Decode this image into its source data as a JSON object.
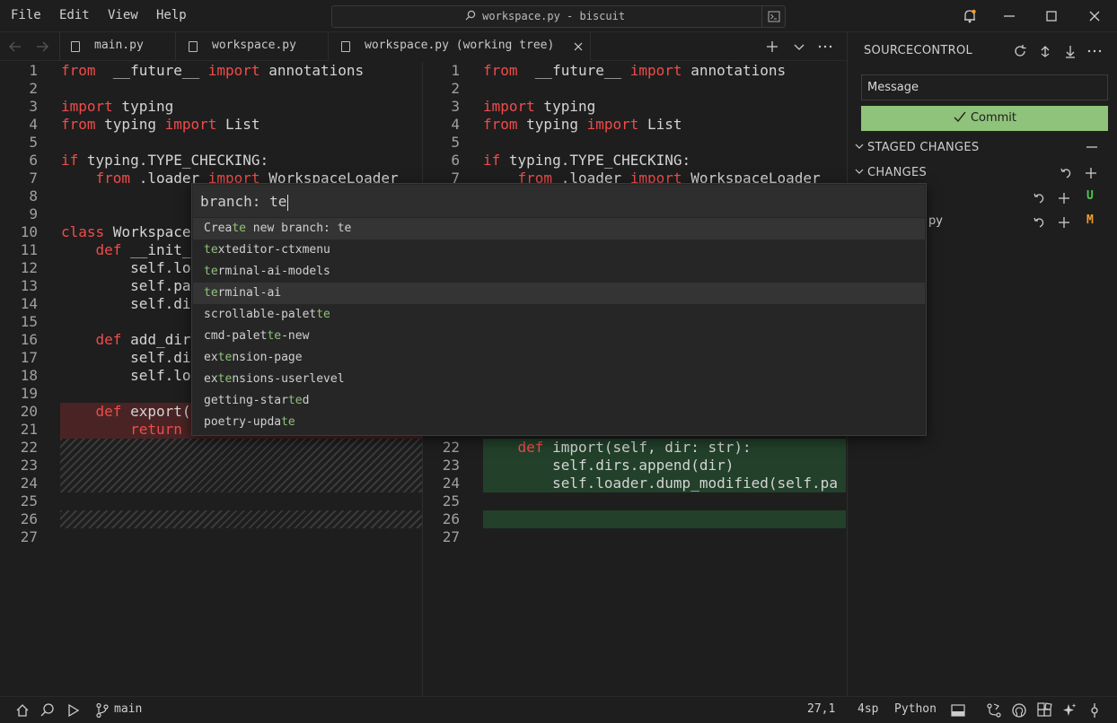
{
  "menu": [
    "File",
    "Edit",
    "View",
    "Help"
  ],
  "title": "workspace.py - biscuit",
  "tabs": [
    {
      "label": "main.py"
    },
    {
      "label": "workspace.py"
    },
    {
      "label": "workspace.py (working tree)"
    }
  ],
  "left_editor": {
    "lines": [
      {
        "n": "1",
        "t": [
          [
            "kw",
            "from"
          ],
          [
            "",
            "  __future__ "
          ],
          [
            "kw",
            "import"
          ],
          [
            "",
            " annotations"
          ]
        ]
      },
      {
        "n": "2",
        "t": []
      },
      {
        "n": "3",
        "t": [
          [
            "kw",
            "import"
          ],
          [
            "",
            " typing"
          ]
        ]
      },
      {
        "n": "4",
        "t": [
          [
            "kw",
            "from"
          ],
          [
            "",
            " typing "
          ],
          [
            "kw",
            "import"
          ],
          [
            "",
            " List"
          ]
        ]
      },
      {
        "n": "5",
        "t": []
      },
      {
        "n": "6",
        "t": [
          [
            "kw",
            "if"
          ],
          [
            "",
            " typing.TYPE_CHECKING:"
          ]
        ]
      },
      {
        "n": "7",
        "t": [
          [
            "",
            "    "
          ],
          [
            "kw",
            "from"
          ],
          [
            "",
            " .loader "
          ],
          [
            "kw",
            "import"
          ],
          [
            "",
            " WorkspaceLoader"
          ]
        ]
      },
      {
        "n": "8",
        "t": []
      },
      {
        "n": "9",
        "t": []
      },
      {
        "n": "10",
        "t": [
          [
            "kw",
            "class"
          ],
          [
            "",
            " Workspace"
          ]
        ]
      },
      {
        "n": "11",
        "t": [
          [
            "",
            "    "
          ],
          [
            "kw",
            "def"
          ],
          [
            "",
            " __init_"
          ]
        ]
      },
      {
        "n": "12",
        "t": [
          [
            "",
            "        self.lo"
          ]
        ]
      },
      {
        "n": "13",
        "t": [
          [
            "",
            "        self.pa"
          ]
        ]
      },
      {
        "n": "14",
        "t": [
          [
            "",
            "        self.di"
          ]
        ]
      },
      {
        "n": "15",
        "t": []
      },
      {
        "n": "16",
        "t": [
          [
            "",
            "    "
          ],
          [
            "kw",
            "def"
          ],
          [
            "",
            " add_dir"
          ]
        ]
      },
      {
        "n": "17",
        "t": [
          [
            "",
            "        self.di"
          ]
        ]
      },
      {
        "n": "18",
        "t": [
          [
            "",
            "        self.lo"
          ]
        ]
      },
      {
        "n": "19",
        "t": []
      },
      {
        "n": "20",
        "t": [
          [
            "",
            "    "
          ],
          [
            "kw",
            "def"
          ],
          [
            "",
            " export("
          ]
        ]
      },
      {
        "n": "21",
        "t": [
          [
            "",
            "        "
          ],
          [
            "kw",
            "return"
          ]
        ]
      },
      {
        "n": "22",
        "t": []
      },
      {
        "n": "23",
        "t": []
      },
      {
        "n": "24",
        "t": []
      },
      {
        "n": "25",
        "t": []
      },
      {
        "n": "26",
        "t": []
      },
      {
        "n": "27",
        "t": []
      }
    ]
  },
  "right_editor": {
    "lines": [
      {
        "n": "1",
        "t": [
          [
            "kw",
            "from"
          ],
          [
            "",
            "  __future__ "
          ],
          [
            "kw",
            "import"
          ],
          [
            "",
            " annotations"
          ]
        ]
      },
      {
        "n": "2",
        "t": []
      },
      {
        "n": "3",
        "t": [
          [
            "kw",
            "import"
          ],
          [
            "",
            " typing"
          ]
        ]
      },
      {
        "n": "4",
        "t": [
          [
            "kw",
            "from"
          ],
          [
            "",
            " typing "
          ],
          [
            "kw",
            "import"
          ],
          [
            "",
            " List"
          ]
        ]
      },
      {
        "n": "5",
        "t": []
      },
      {
        "n": "6",
        "t": [
          [
            "kw",
            "if"
          ],
          [
            "",
            " typing.TYPE_CHECKING:"
          ]
        ]
      },
      {
        "n": "7",
        "t": [
          [
            "",
            "    "
          ],
          [
            "kw",
            "from"
          ],
          [
            "",
            " .loader "
          ],
          [
            "kw",
            "import"
          ],
          [
            "",
            " WorkspaceLoader"
          ]
        ]
      },
      {
        "n": "22",
        "t": [
          [
            "",
            "    "
          ],
          [
            "kw",
            "def"
          ],
          [
            "",
            " import(self, dir: str):"
          ]
        ]
      },
      {
        "n": "23",
        "t": [
          [
            "",
            "        self.dirs.append(dir)"
          ]
        ]
      },
      {
        "n": "24",
        "t": [
          [
            "",
            "        self.loader.dump_modified(self.pa"
          ]
        ]
      },
      {
        "n": "25",
        "t": []
      },
      {
        "n": "26",
        "t": []
      },
      {
        "n": "27",
        "t": []
      }
    ]
  },
  "sidebar": {
    "title": "SOURCECONTROL",
    "message_placeholder": "Message",
    "commit_label": "Commit",
    "staged_label": "STAGED CHANGES",
    "changes_label": "CHANGES",
    "files": [
      {
        "name": "",
        "status": "U"
      },
      {
        "name": "py",
        "status": "M"
      }
    ]
  },
  "palette": {
    "prefix": "branch: ",
    "query": "te",
    "items": [
      {
        "segments": [
          [
            "",
            "Crea"
          ],
          [
            "m",
            "te"
          ],
          [
            "",
            " new branch: te"
          ]
        ]
      },
      {
        "segments": [
          [
            "m",
            "te"
          ],
          [
            "",
            "xteditor-ctxmenu"
          ]
        ]
      },
      {
        "segments": [
          [
            "m",
            "te"
          ],
          [
            "",
            "rminal-ai-models"
          ]
        ]
      },
      {
        "segments": [
          [
            "m",
            "te"
          ],
          [
            "",
            "rminal-ai"
          ]
        ]
      },
      {
        "segments": [
          [
            "",
            "scrollable-palet"
          ],
          [
            "m",
            "te"
          ]
        ]
      },
      {
        "segments": [
          [
            "",
            "cmd-palet"
          ],
          [
            "m",
            "te"
          ],
          [
            "",
            "-new"
          ]
        ]
      },
      {
        "segments": [
          [
            "",
            "ex"
          ],
          [
            "m",
            "te"
          ],
          [
            "",
            "nsion-page"
          ]
        ]
      },
      {
        "segments": [
          [
            "",
            "ex"
          ],
          [
            "m",
            "te"
          ],
          [
            "",
            "nsions-userlevel"
          ]
        ]
      },
      {
        "segments": [
          [
            "",
            "getting-star"
          ],
          [
            "m",
            "te"
          ],
          [
            "",
            "d"
          ]
        ]
      },
      {
        "segments": [
          [
            "",
            "poetry-upda"
          ],
          [
            "m",
            "te"
          ]
        ]
      }
    ]
  },
  "status": {
    "branch": "main",
    "position": "27,1",
    "indent": "4sp",
    "language": "Python"
  },
  "colors": {
    "keyword": "#f14b4b",
    "match": "#8fc27a",
    "commit": "#8fc27a",
    "untracked": "#4ec94e",
    "modified": "#f0a030"
  }
}
